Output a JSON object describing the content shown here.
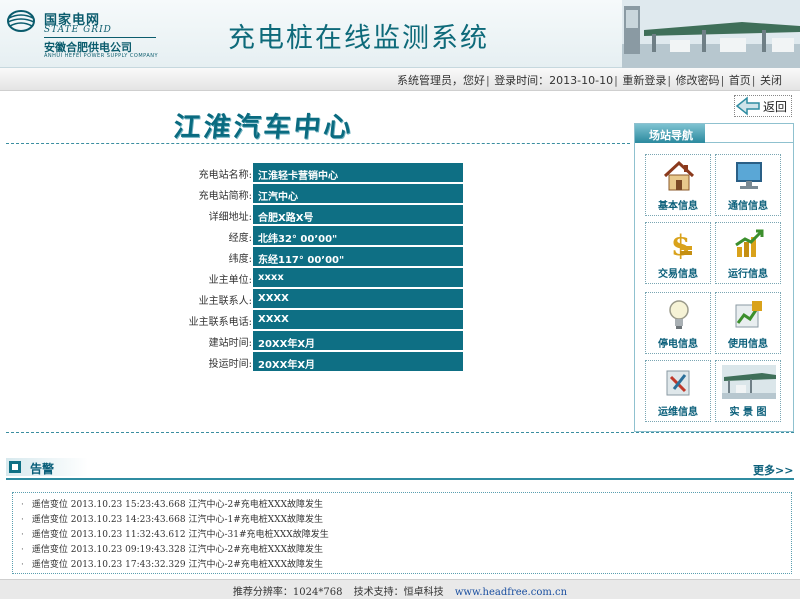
{
  "header": {
    "logo_cn": "国家电网",
    "logo_en": "STATE GRID",
    "logo_sub": "安徽合肥供电公司",
    "logo_sub_en": "ANHUI HEFEI POWER SUPPLY COMPANY",
    "title": "充电桩在线监测系统"
  },
  "topbar": {
    "user_greeting": "系统管理员，您好",
    "login_time": "登录时间：2013-10-10",
    "relogin": "重新登录",
    "change_password": "修改密码",
    "home": "首页",
    "close": "关闭"
  },
  "station": {
    "name": "江淮汽车中心",
    "back_label": "返回"
  },
  "info": {
    "rows": [
      {
        "label": "充电站名称:",
        "value": "江淮轻卡营销中心"
      },
      {
        "label": "充电站简称:",
        "value": "江汽中心"
      },
      {
        "label": "详细地址:",
        "value": "合肥X路X号"
      },
      {
        "label": "经度:",
        "value": "北纬32° 00’00\""
      },
      {
        "label": "纬度:",
        "value": "东经117° 00’00\""
      },
      {
        "label": "业主单位:",
        "value": "xxxx"
      },
      {
        "label": "业主联系人:",
        "value": "XXXX"
      },
      {
        "label": "业主联系电话:",
        "value": "XXXX"
      },
      {
        "label": "建站时间:",
        "value": "20XX年X月"
      },
      {
        "label": "投运时间:",
        "value": "20XX年X月"
      }
    ]
  },
  "nav": {
    "title": "场站导航",
    "items": [
      {
        "label": "基本信息",
        "icon": "house-icon"
      },
      {
        "label": "通信信息",
        "icon": "monitor-icon"
      },
      {
        "label": "交易信息",
        "icon": "dollar-icon"
      },
      {
        "label": "运行信息",
        "icon": "growth-chart-icon"
      },
      {
        "label": "停电信息",
        "icon": "lightbulb-icon"
      },
      {
        "label": "使用信息",
        "icon": "document-chart-icon"
      },
      {
        "label": "运维信息",
        "icon": "tools-icon"
      },
      {
        "label": "实 景 图",
        "icon": "station-photo-icon"
      }
    ]
  },
  "alarm": {
    "title": "告警",
    "more": "更多>>",
    "items": [
      "遥信变位 2013.10.23 15:23:43.668 江汽中心-2#充电桩XXX故障发生",
      "遥信变位 2013.10.23 14:23:43.668 江汽中心-1#充电桩XXX故障发生",
      "遥信变位 2013.10.23 11:32:43.612 江汽中心-31#充电桩XXX故障发生",
      "遥信变位 2013.10.23 09:19:43.328 江汽中心-2#充电桩XXX故障发生",
      "遥信变位 2013.10.23 17:43:32.329 江汽中心-2#充电桩XXX故障发生"
    ]
  },
  "footer": {
    "resolution": "推荐分辨率：1024*768",
    "support": "技术支持：恒卓科技",
    "link": "www.headfree.com.cn"
  },
  "colors": {
    "accent": "#0e6f84",
    "title": "#0a6b80",
    "link": "#1a4fa0"
  }
}
